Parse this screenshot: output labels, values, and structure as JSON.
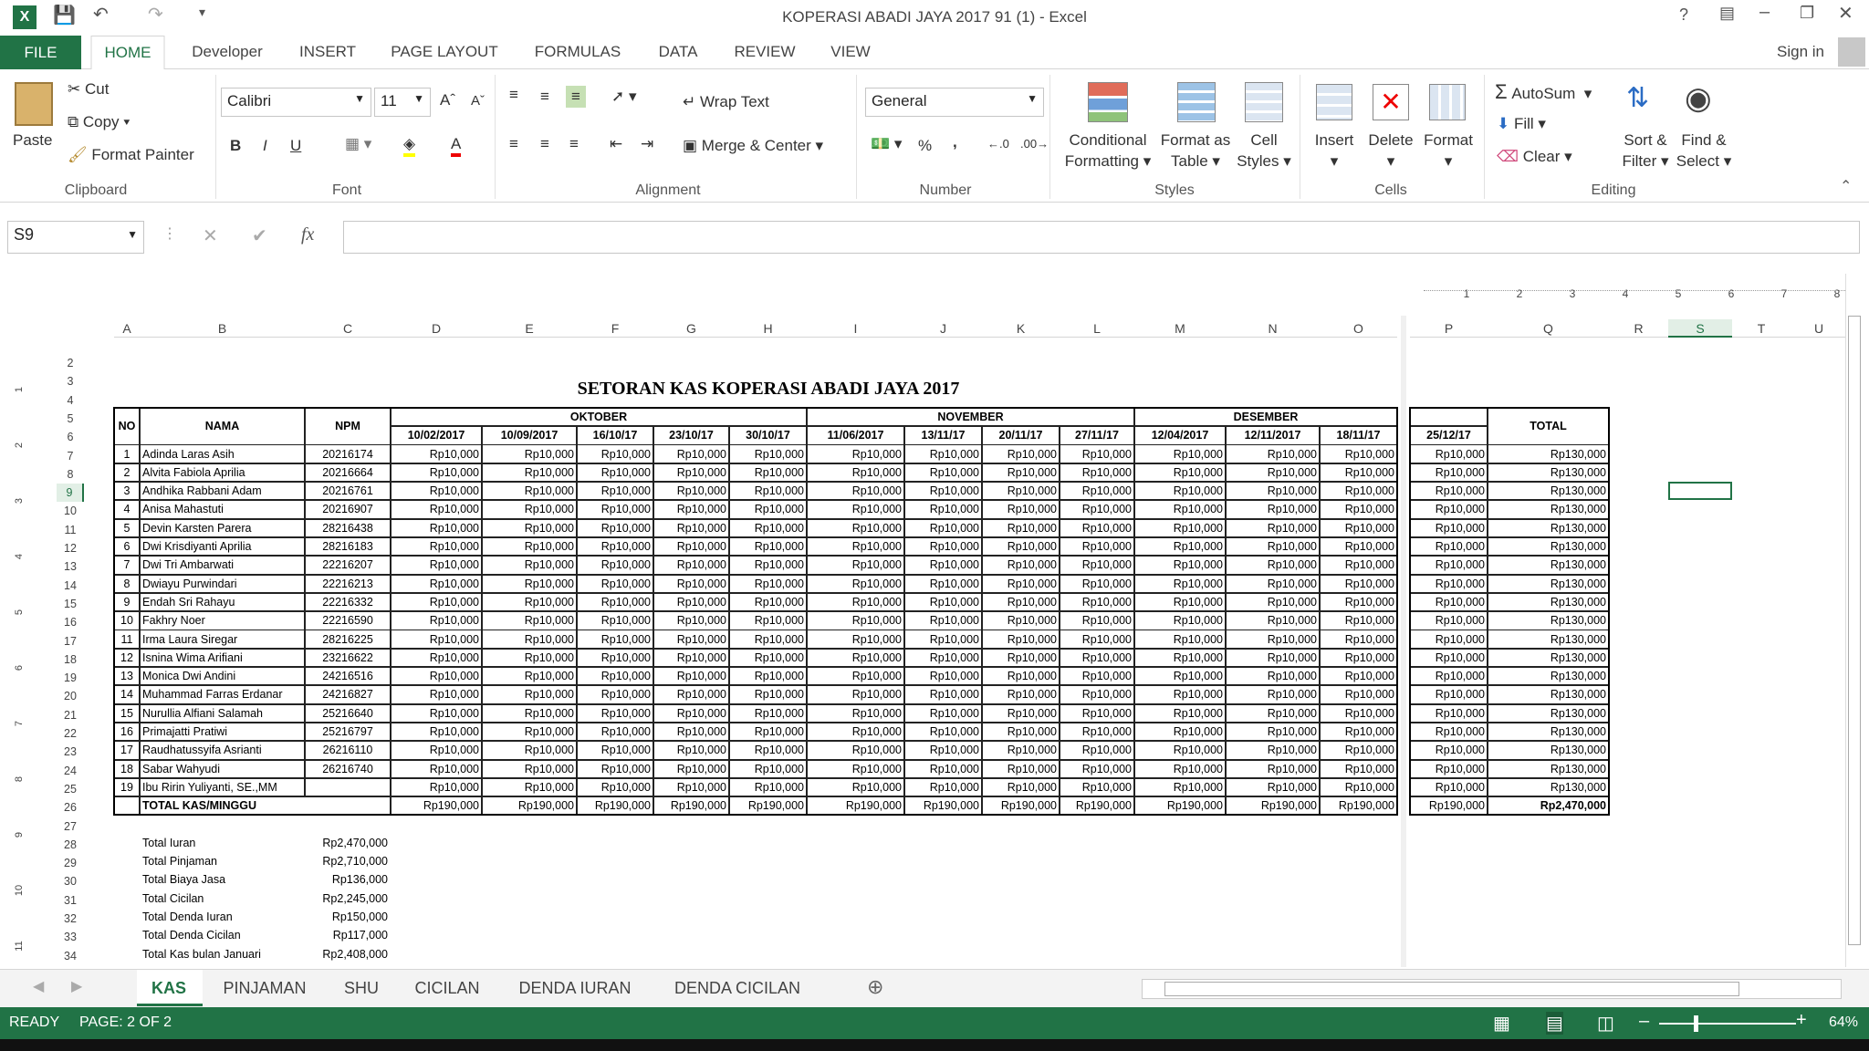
{
  "window": {
    "title": "KOPERASI ABADI JAYA 2017 91 (1) - Excel",
    "help": "?",
    "sign_in": "Sign in"
  },
  "tabs": [
    "FILE",
    "HOME",
    "Developer",
    "INSERT",
    "PAGE LAYOUT",
    "FORMULAS",
    "DATA",
    "REVIEW",
    "VIEW"
  ],
  "ribbon": {
    "clipboard": {
      "paste": "Paste",
      "cut": "Cut",
      "copy": "Copy",
      "format_painter": "Format Painter",
      "label": "Clipboard"
    },
    "font": {
      "name": "Calibri",
      "size": "11",
      "label": "Font",
      "bold": "B",
      "italic": "I",
      "underline": "U"
    },
    "alignment": {
      "wrap": "Wrap Text",
      "merge": "Merge & Center",
      "label": "Alignment"
    },
    "number": {
      "format": "General",
      "label": "Number",
      "percent": "%",
      "comma": ","
    },
    "styles": {
      "conditional": "Conditional",
      "conditional2": "Formatting",
      "format_table": "Format as",
      "format_table2": "Table",
      "cell_styles": "Cell",
      "cell_styles2": "Styles",
      "label": "Styles"
    },
    "cells": {
      "insert": "Insert",
      "delete": "Delete",
      "format": "Format",
      "label": "Cells"
    },
    "editing": {
      "autosum": "AutoSum",
      "fill": "Fill",
      "clear": "Clear",
      "sort": "Sort &",
      "sort2": "Filter",
      "find": "Find &",
      "find2": "Select",
      "label": "Editing"
    }
  },
  "formula_bar": {
    "name_box": "S9",
    "fx": "fx",
    "value": ""
  },
  "ruler": [
    "1",
    "2",
    "3",
    "4",
    "5",
    "6",
    "7",
    "8"
  ],
  "left_ruler": [
    "1",
    "2",
    "3",
    "4",
    "5",
    "6",
    "7",
    "8",
    "9",
    "10",
    "11"
  ],
  "columns": [
    "A",
    "B",
    "C",
    "D",
    "E",
    "F",
    "G",
    "H",
    "I",
    "J",
    "K",
    "L",
    "M",
    "N",
    "O",
    "P",
    "Q",
    "R",
    "S",
    "T",
    "U"
  ],
  "sheet": {
    "title": "SETORAN KAS KOPERASI ABADI JAYA 2017",
    "headers": {
      "no": "NO",
      "nama": "NAMA",
      "npm": "NPM",
      "total": "TOTAL"
    },
    "months": [
      "OKTOBER",
      "NOVEMBER",
      "DESEMBER"
    ],
    "dates": [
      "10/02/2017",
      "10/09/2017",
      "16/10/17",
      "23/10/17",
      "30/10/17",
      "11/06/2017",
      "13/11/17",
      "20/11/17",
      "27/11/17",
      "12/04/2017",
      "12/11/2017",
      "18/11/17",
      "25/12/17"
    ],
    "members": [
      {
        "no": "1",
        "name": "Adinda Laras Asih",
        "npm": "20216174"
      },
      {
        "no": "2",
        "name": "Alvita Fabiola Aprilia",
        "npm": "20216664"
      },
      {
        "no": "3",
        "name": "Andhika Rabbani Adam",
        "npm": "20216761"
      },
      {
        "no": "4",
        "name": "Anisa Mahastuti",
        "npm": "20216907"
      },
      {
        "no": "5",
        "name": "Devin Karsten Parera",
        "npm": "28216438"
      },
      {
        "no": "6",
        "name": "Dwi Krisdiyanti Aprilia",
        "npm": "28216183"
      },
      {
        "no": "7",
        "name": "Dwi Tri Ambarwati",
        "npm": "22216207"
      },
      {
        "no": "8",
        "name": "Dwiayu Purwindari",
        "npm": "22216213"
      },
      {
        "no": "9",
        "name": "Endah Sri Rahayu",
        "npm": "22216332"
      },
      {
        "no": "10",
        "name": "Fakhry Noer",
        "npm": "22216590"
      },
      {
        "no": "11",
        "name": "Irma Laura Siregar",
        "npm": "28216225"
      },
      {
        "no": "12",
        "name": "Isnina Wima Arifiani",
        "npm": "23216622"
      },
      {
        "no": "13",
        "name": "Monica Dwi Andini",
        "npm": "24216516"
      },
      {
        "no": "14",
        "name": "Muhammad Farras Erdanar",
        "npm": "24216827"
      },
      {
        "no": "15",
        "name": "Nurullia Alfiani Salamah",
        "npm": "25216640"
      },
      {
        "no": "16",
        "name": "Primajatti Pratiwi",
        "npm": "25216797"
      },
      {
        "no": "17",
        "name": "Raudhatussyifa Asrianti",
        "npm": "26216110"
      },
      {
        "no": "18",
        "name": "Sabar Wahyudi",
        "npm": "26216740"
      },
      {
        "no": "19",
        "name": "Ibu Ririn Yuliyanti, SE.,MM",
        "npm": ""
      }
    ],
    "payment": "Rp10,000",
    "member_total": "Rp130,000",
    "total_label": "TOTAL KAS/MINGGU",
    "weekly_total": "Rp190,000",
    "grand_total": "Rp2,470,000",
    "summary": [
      {
        "label": "Total Iuran",
        "value": "Rp2,470,000"
      },
      {
        "label": "Total Pinjaman",
        "value": "Rp2,710,000"
      },
      {
        "label": "Total Biaya Jasa",
        "value": "Rp136,000"
      },
      {
        "label": "Total Cicilan",
        "value": "Rp2,245,000"
      },
      {
        "label": "Total Denda Iuran",
        "value": "Rp150,000"
      },
      {
        "label": "Total Denda Cicilan",
        "value": "Rp117,000"
      },
      {
        "label": "Total Kas bulan Januari",
        "value": "Rp2,408,000"
      }
    ]
  },
  "sheet_tabs": [
    "KAS",
    "PINJAMAN",
    "SHU",
    "CICILAN",
    "DENDA IURAN",
    "DENDA CICILAN"
  ],
  "status": {
    "mode": "READY",
    "page": "PAGE: 2 OF 2",
    "zoom": "64%",
    "zoom_value": 64
  },
  "colors": {
    "accent": "#217346",
    "selected": "#217346"
  }
}
